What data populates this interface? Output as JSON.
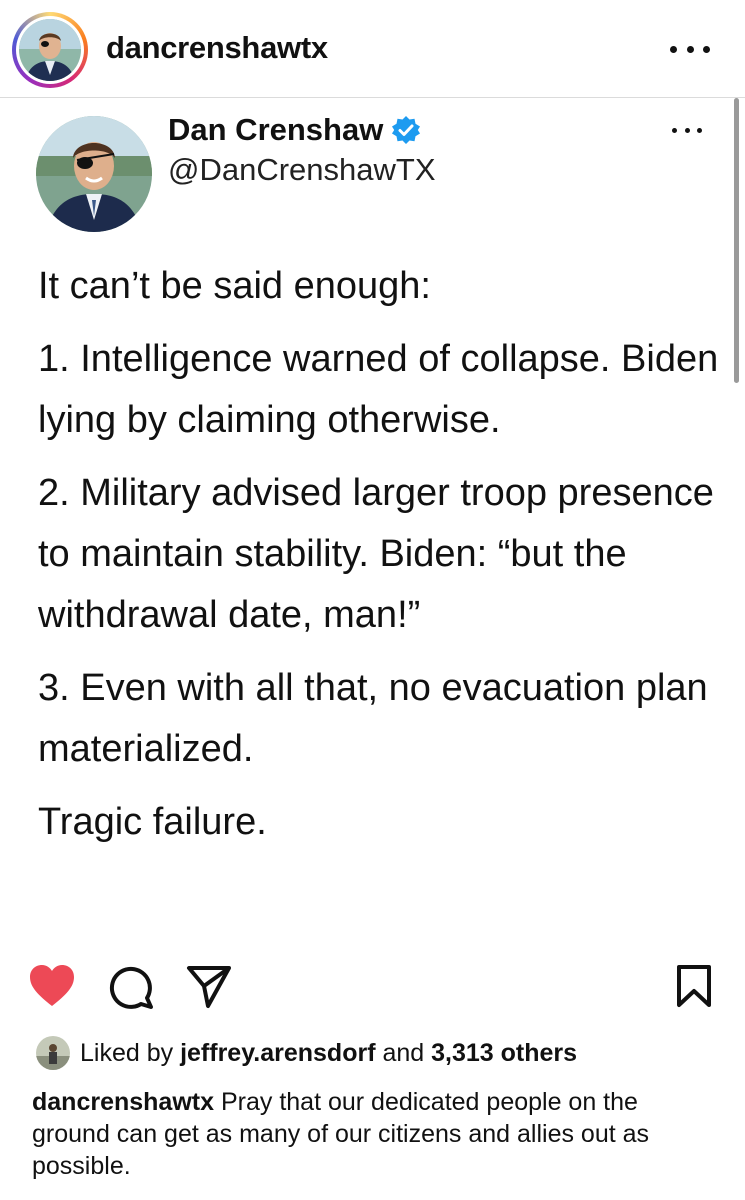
{
  "header": {
    "username": "dancrenshawtx"
  },
  "tweet": {
    "display_name": "Dan Crenshaw",
    "handle": "@DanCrenshawTX",
    "paragraphs": [
      "It can’t be said enough:",
      "1. Intelligence warned of collapse. Biden lying by claiming otherwise.",
      "2. Military advised larger troop presence to maintain stability. Biden: “but the withdrawal date, man!”",
      "3. Even with all that, no evacuation plan materialized.",
      "Tragic failure."
    ]
  },
  "likes": {
    "prefix": "Liked by",
    "user": "jeffrey.arensdorf",
    "middle": "and",
    "count": "3,313 others"
  },
  "caption": {
    "username": "dancrenshawtx",
    "text": "Pray that our dedicated people on the ground can get as many of our citizens and allies out as possible."
  },
  "colors": {
    "like_red": "#ed4956",
    "verified_blue": "#1d9bf0",
    "divider": "#dbdbdb"
  },
  "icons": [
    "heart-icon",
    "comment-icon",
    "share-icon",
    "bookmark-icon",
    "more-icon",
    "verified-badge-icon"
  ]
}
